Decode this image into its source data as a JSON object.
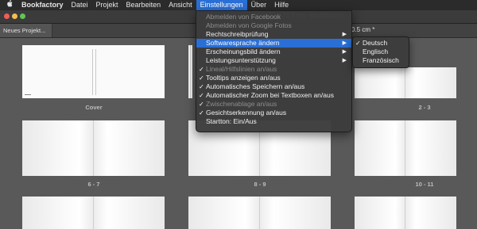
{
  "menubar": {
    "apple": "",
    "items": [
      "Bookfactory",
      "Datei",
      "Projekt",
      "Bearbeiten",
      "Ansicht",
      "Einstellungen",
      "Über",
      "Hilfe"
    ]
  },
  "window": {
    "title": "Wide 27 x 20.5 cm - Bookfactory",
    "partial_title": "0.5 cm *",
    "traffic_colors": [
      "#ee5e57",
      "#f5bd4f",
      "#62c554"
    ]
  },
  "tabs": [
    "Neues Projekt..."
  ],
  "pages": {
    "row1": [
      "Cover",
      "",
      "2 - 3"
    ],
    "row2": [
      "6 - 7",
      "8 - 9",
      "10 - 11"
    ]
  },
  "settings_menu": {
    "items": [
      {
        "label": "Abmelden von Facebook",
        "check": "",
        "arrow": "",
        "state": "dis"
      },
      {
        "label": "Abmelden von Google Fotos",
        "check": "",
        "arrow": "",
        "state": "dis"
      },
      {
        "label": "Rechtschreibprüfung",
        "check": "",
        "arrow": "▶",
        "state": "en"
      },
      {
        "label": "Softwaresprache ändern",
        "check": "",
        "arrow": "▶",
        "state": "hl"
      },
      {
        "label": "Erscheinungsbild ändern",
        "check": "",
        "arrow": "▶",
        "state": "en"
      },
      {
        "label": "Leistungsunterstützung",
        "check": "",
        "arrow": "▶",
        "state": "en"
      },
      {
        "label": "Lineal/Hilfslinien an/aus",
        "check": "✓",
        "arrow": "",
        "state": "dis"
      },
      {
        "label": "Tooltips anzeigen an/aus",
        "check": "✓",
        "arrow": "",
        "state": "en"
      },
      {
        "label": "Automatisches Speichern an/aus",
        "check": "✓",
        "arrow": "",
        "state": "en"
      },
      {
        "label": "Automatischer Zoom bei Textboxen an/aus",
        "check": "✓",
        "arrow": "",
        "state": "en"
      },
      {
        "label": "Zwischenablage an/aus",
        "check": "✓",
        "arrow": "",
        "state": "dis"
      },
      {
        "label": "Gesichtserkennung an/aus",
        "check": "✓",
        "arrow": "",
        "state": "en"
      },
      {
        "label": "Startton: Ein/Aus",
        "check": "",
        "arrow": "",
        "state": "en"
      }
    ]
  },
  "language_submenu": {
    "items": [
      {
        "label": "Deutsch",
        "check": "✓"
      },
      {
        "label": "Englisch",
        "check": ""
      },
      {
        "label": "Französisch",
        "check": ""
      }
    ]
  },
  "accent_color": "#2a6fd6"
}
